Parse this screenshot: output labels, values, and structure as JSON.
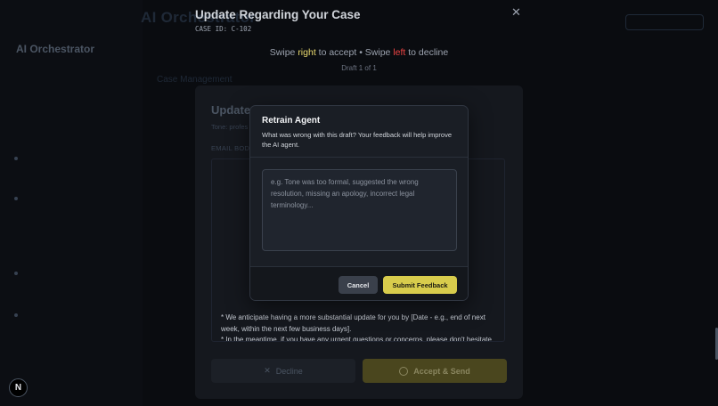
{
  "colors": {
    "accent": "#d8cc4c",
    "accept_word": "#e8d86e",
    "decline_word": "#ef4444",
    "modal_bg": "#1a1e25"
  },
  "background": {
    "sidebar_brand": "AI Orchestrator",
    "new_badge": "N",
    "section_title": "Case Management"
  },
  "review": {
    "title": "Update Regarding Your Case",
    "case_id": "CASE ID: C-102",
    "close_icon": "close-icon",
    "swipe_prefix": "Swipe ",
    "swipe_right": "right",
    "swipe_mid": " to accept • Swipe ",
    "swipe_left": "left",
    "swipe_suffix": " to decline",
    "draft_counter": "Draft 1 of 1",
    "draft_subject": "Update",
    "tone_label": "Tone: profes",
    "email_body_label": "EMAIL BOD",
    "email_visible_lines": [
      "* We anticipate having a more substantial update for you by [Date - e.g., end of next week, within the next few business days].",
      "* In the meantime, if you have any urgent questions or concerns, please don't hesitate to contact me directly by replying to this email or calling me at [Phone number]."
    ],
    "decline_label": "Decline",
    "accept_label": "Accept & Send"
  },
  "modal": {
    "title": "Retrain Agent",
    "description": "What was wrong with this draft? Your feedback will help improve the AI agent.",
    "textarea_placeholder": "e.g. Tone was too formal, suggested the wrong resolution, missing an apology, incorrect legal terminology...",
    "textarea_value": "",
    "cancel_label": "Cancel",
    "submit_label": "Submit Feedback"
  }
}
